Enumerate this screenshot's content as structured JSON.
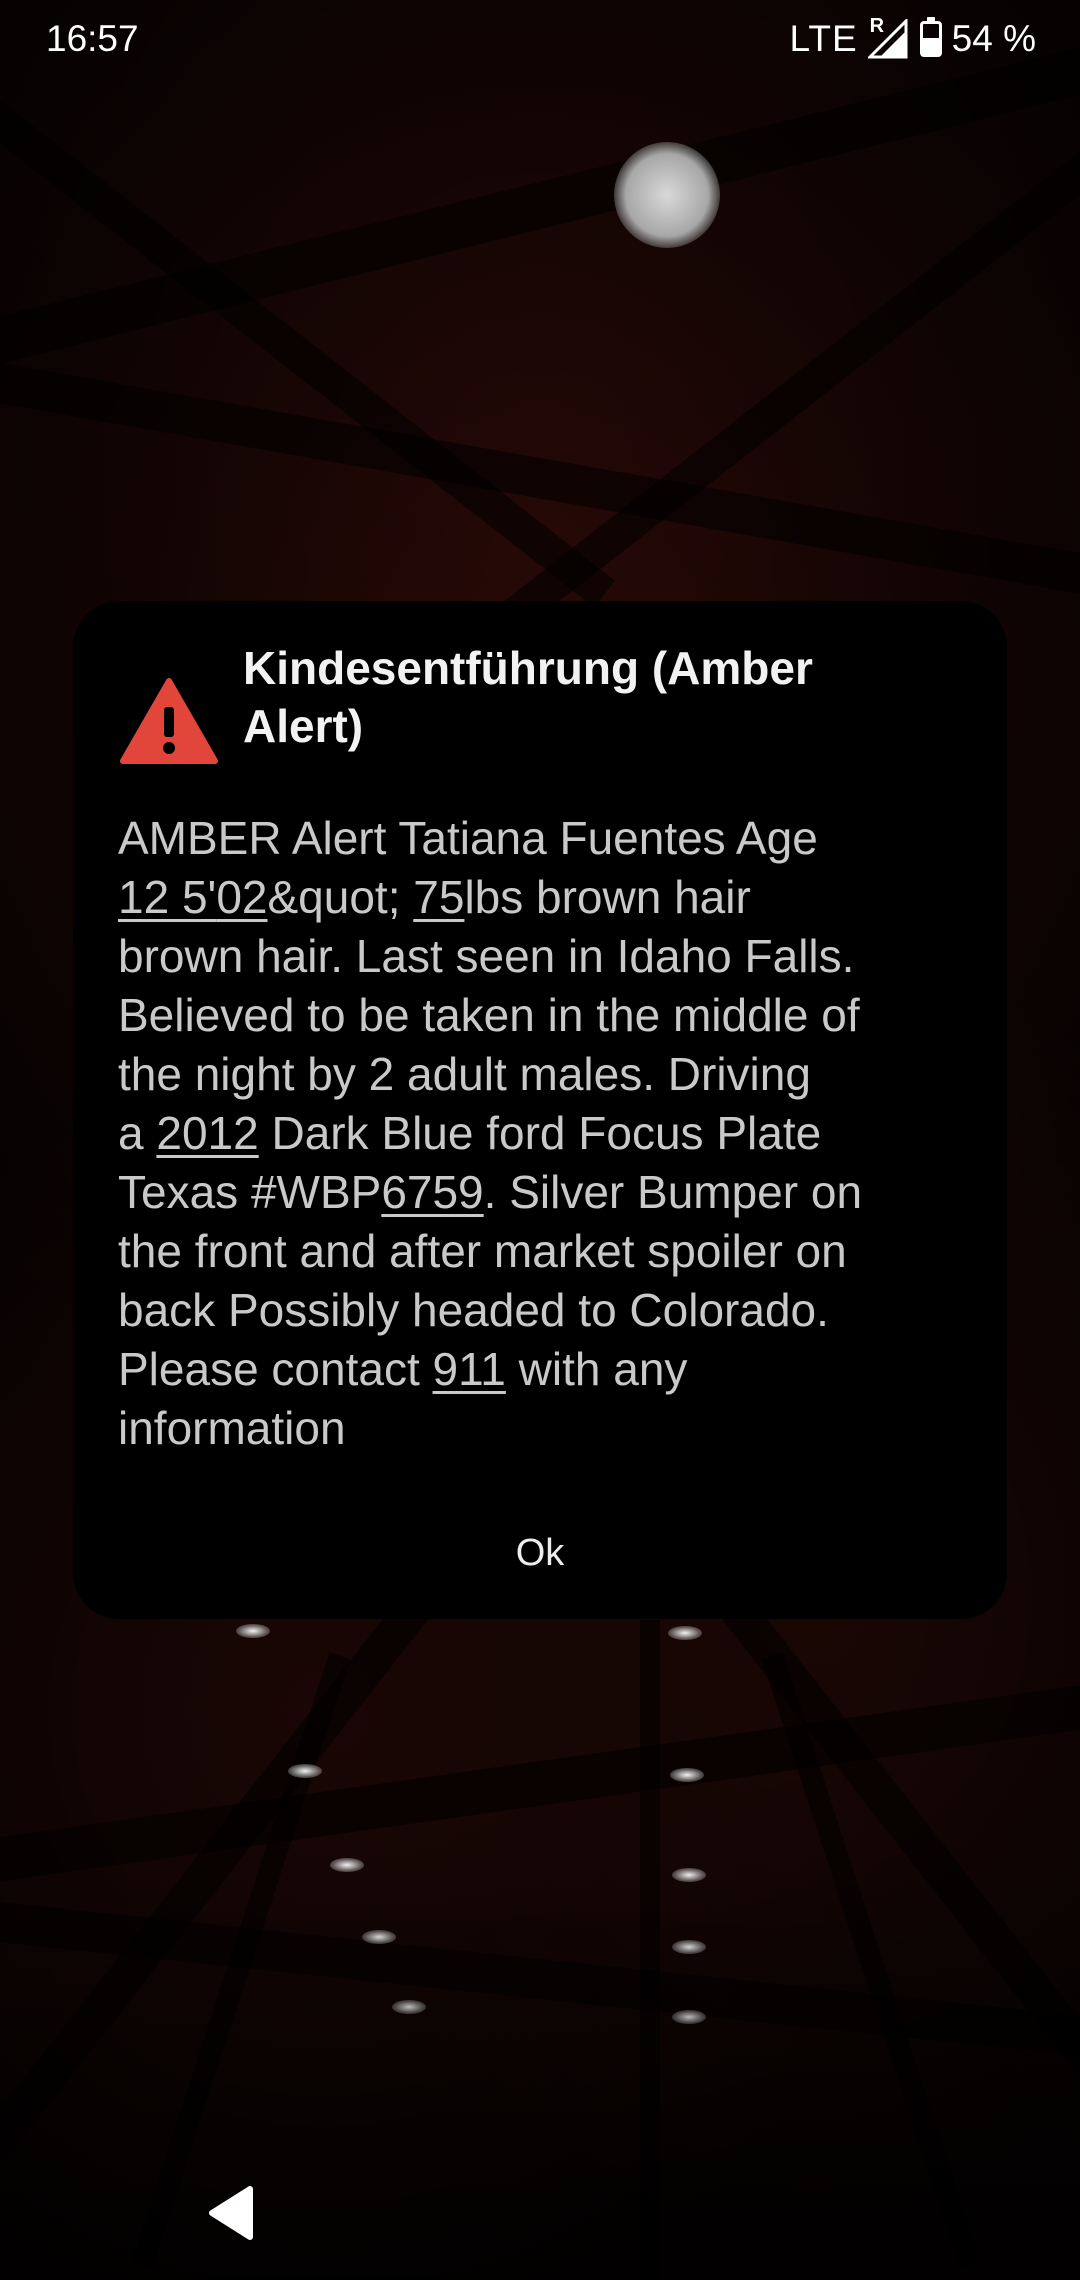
{
  "status_bar": {
    "time": "16:57",
    "network": "LTE",
    "roaming_indicator": "R",
    "battery_percent": 54,
    "battery_label": "54 %",
    "icons": [
      "signal-icon",
      "battery-icon"
    ]
  },
  "dialog": {
    "icon": "warning-triangle-icon",
    "icon_color": "#e2453a",
    "title": "Kindesentführung (Amber Alert)",
    "body_lines": [
      [
        {
          "t": "AMBER Alert Tatiana Fuentes Age"
        }
      ],
      [
        {
          "t": "12 5'",
          "link": true
        },
        {
          "t": "02",
          "link": true
        },
        {
          "t": "&quot; "
        },
        {
          "t": "75",
          "link": true
        },
        {
          "t": "lbs brown hair"
        }
      ],
      [
        {
          "t": "brown hair. Last seen in Idaho Falls."
        }
      ],
      [
        {
          "t": "Believed to be taken in the middle of"
        }
      ],
      [
        {
          "t": "the night by 2 adult males. Driving"
        }
      ],
      [
        {
          "t": "a "
        },
        {
          "t": "2012",
          "link": true
        },
        {
          "t": " Dark Blue ford Focus Plate"
        }
      ],
      [
        {
          "t": "Texas #WBP"
        },
        {
          "t": "6759",
          "link": true
        },
        {
          "t": ". Silver Bumper on"
        }
      ],
      [
        {
          "t": "the front and after market spoiler on"
        }
      ],
      [
        {
          "t": "back Possibly headed to Colorado."
        }
      ],
      [
        {
          "t": "Please contact "
        },
        {
          "t": "911",
          "link": true
        },
        {
          "t": " with any"
        }
      ],
      [
        {
          "t": "information"
        }
      ]
    ],
    "ok_label": "Ok"
  },
  "nav_bar": {
    "back_icon": "back-triangle-icon"
  },
  "colors": {
    "dialog_bg": "#000000",
    "title_text": "#f2f2f2",
    "body_text": "#c9c9c9",
    "wallpaper_accent": "#3a0f0a"
  }
}
